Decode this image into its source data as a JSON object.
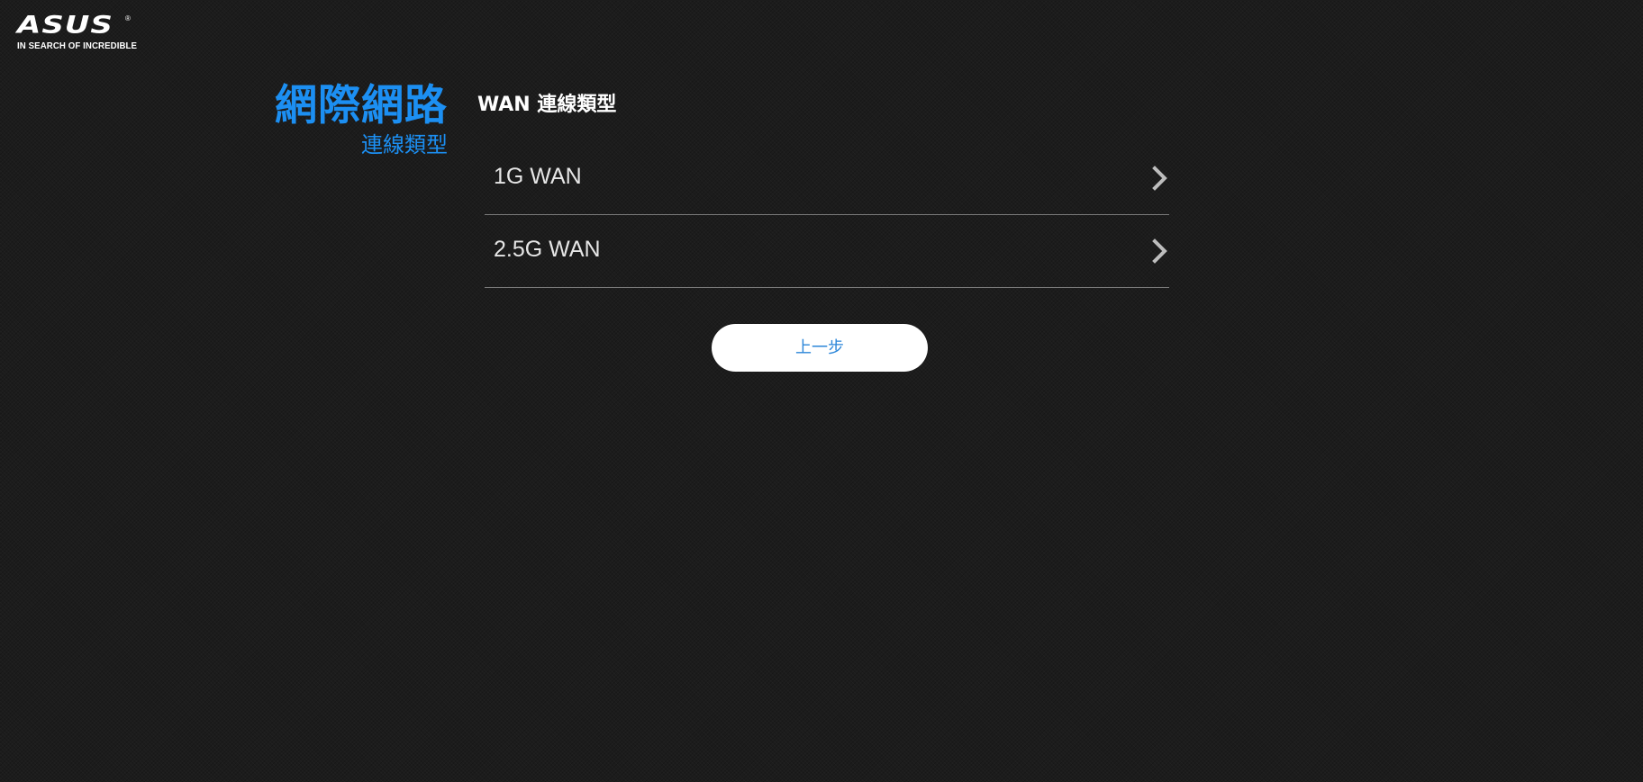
{
  "brand": {
    "logo_text": "ASUS",
    "registered_mark": "®",
    "tagline": "IN SEARCH OF INCREDIBLE"
  },
  "sidebar_title": {
    "main": "網際網路",
    "sub": "連線類型"
  },
  "section": {
    "heading": "WAN 連線類型"
  },
  "options": [
    {
      "label": "1G WAN",
      "icon": "chevron-right-icon"
    },
    {
      "label": "2.5G WAN",
      "icon": "chevron-right-icon"
    }
  ],
  "back_button": {
    "label": "上一步"
  },
  "colors": {
    "accent": "#1c8ff2",
    "background": "#1c1c1c",
    "button_bg": "#ffffff",
    "button_text": "#2b86d9",
    "divider": "#7a7a7a"
  }
}
